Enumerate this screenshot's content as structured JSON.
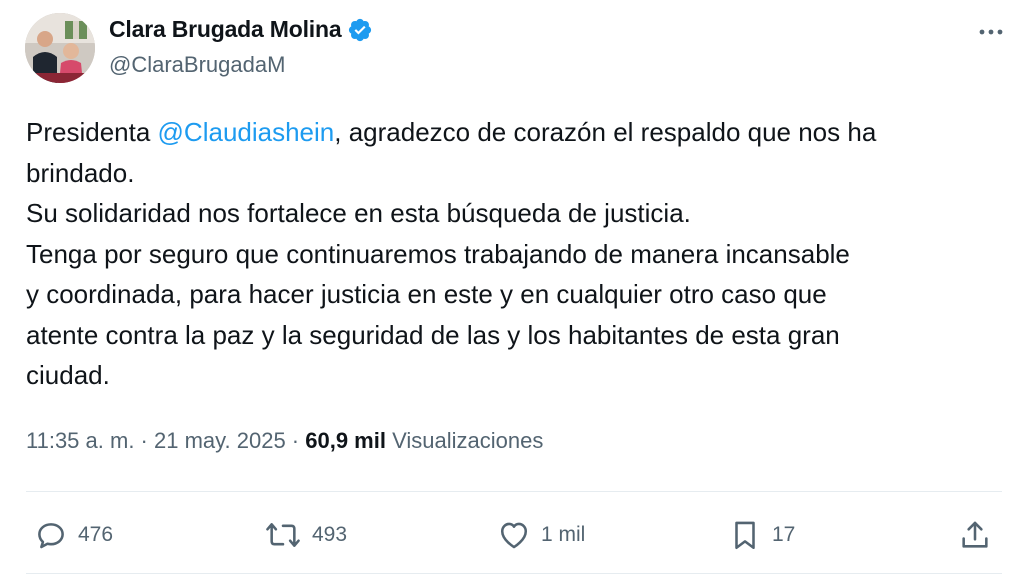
{
  "author": {
    "display_name": "Clara Brugada Molina",
    "handle": "@ClaraBrugadaM",
    "verified": true
  },
  "tweet": {
    "lines": [
      {
        "prefix": "Presidenta ",
        "mention": "@Claudiashein",
        "suffix": ", agradezco de corazón el respaldo que nos ha"
      },
      {
        "text": "brindado."
      },
      {
        "text": "Su solidaridad nos fortalece en esta búsqueda de justicia."
      },
      {
        "text": "Tenga por seguro que continuaremos trabajando de manera incansable"
      },
      {
        "text": "y coordinada, para hacer justicia en este y en cualquier otro caso que"
      },
      {
        "text": "atente contra la paz y la seguridad de las y los habitantes de esta gran"
      },
      {
        "text": "ciudad."
      }
    ]
  },
  "meta": {
    "time": "11:35 a. m.",
    "separator": " · ",
    "date": "21 may. 2025",
    "views_count": "60,9 mil",
    "views_label": " Visualizaciones"
  },
  "actions": {
    "replies": "476",
    "reposts": "493",
    "likes": "1 mil",
    "bookmarks": "17"
  },
  "colors": {
    "accent": "#1d9bf0",
    "text": "#0f1419",
    "secondary": "#536471"
  },
  "icons": {
    "verified": "verified-badge-icon",
    "more": "more-horizontal-icon",
    "reply": "reply-icon",
    "repost": "repost-icon",
    "like": "heart-icon",
    "bookmark": "bookmark-icon",
    "share": "share-icon"
  }
}
